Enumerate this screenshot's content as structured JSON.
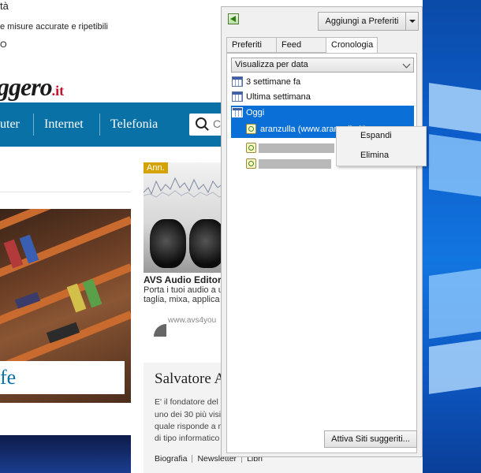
{
  "webpage": {
    "top_line_1": "tà",
    "top_line_2": "e misure accurate e ripetibili",
    "top_line_3": "O",
    "logo_text": "ggero",
    "logo_tld": ".it",
    "nav": [
      "uter",
      "Internet",
      "Telefonia"
    ],
    "search_placeholder": "C",
    "left_caption": "fe",
    "avs": {
      "badge": "Ann.",
      "title": "AVS Audio Editor",
      "desc_1": "Porta i tuoi audio a u",
      "desc_2": "taglia, mixa, applica e",
      "url": "www.avs4you"
    },
    "author": {
      "name": "Salvatore A",
      "bio": [
        "E' il fondatore del",
        "uno dei 30 più visi",
        "quale risponde a n",
        "di tipo informatico"
      ],
      "links": [
        "Biografia",
        "Newsletter",
        "Libri"
      ]
    }
  },
  "panel": {
    "add_favorites_label": "Aggiungi a Preferiti",
    "tabs": [
      {
        "label": "Preferiti",
        "active": false
      },
      {
        "label": "Feed",
        "active": false
      },
      {
        "label": "Cronologia",
        "active": true
      }
    ],
    "view_select_value": "Visualizza per data",
    "history": [
      {
        "label": "3 settimane fa",
        "selected": false
      },
      {
        "label": "Ultima settimana",
        "selected": false
      },
      {
        "label": "Oggi",
        "selected": true
      }
    ],
    "site_entry": "aranzulla (www.aranzulla.it)",
    "suggest_button_label": "Attiva Siti suggeriti..."
  },
  "context_menu": {
    "items": [
      "Espandi",
      "Elimina"
    ]
  },
  "colors": {
    "nav_blue": "#0a71a6",
    "selection_blue": "#0a6fd6",
    "desktop_blue": "#0d5fcc"
  }
}
